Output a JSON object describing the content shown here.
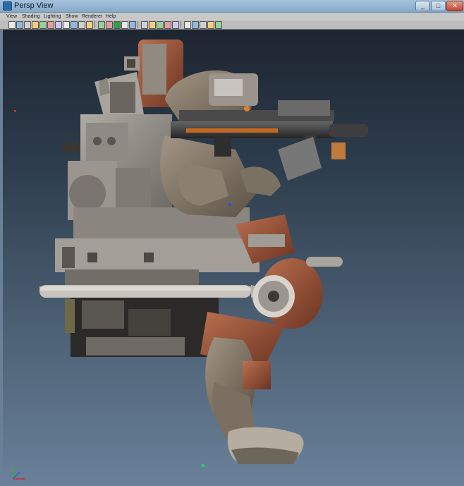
{
  "window": {
    "title": "Persp View"
  },
  "title_buttons": [
    {
      "name": "minimize-button",
      "glyph": "_"
    },
    {
      "name": "maximize-button",
      "glyph": "□"
    },
    {
      "name": "close-button",
      "glyph": "✕"
    }
  ],
  "menu": [
    "View",
    "Shading",
    "Lighting",
    "Show",
    "Renderer",
    "Help"
  ],
  "toolbar_icons": [
    "camera-select-icon",
    "camera-attributes-icon",
    "bookmark-icon",
    "image-plane-icon",
    "grid-icon",
    "film-gate-icon",
    "resolution-gate-icon",
    "gate-mask-icon",
    "field-chart-icon",
    "safe-action-icon",
    "safe-title-icon",
    "wireframe-icon",
    "smooth-shade-icon",
    "wireframe-on-shaded-icon",
    "textured-icon",
    "use-all-lights-icon",
    "shadows-icon",
    "x-ray-icon",
    "backface-cull-icon",
    "isolate-select-icon",
    "highlight-icon",
    "ambient-occlusion-icon",
    "motion-blur-icon",
    "anti-alias-icon",
    "depth-of-field-icon",
    "render-view-icon"
  ],
  "colors": {
    "toolbar_accent": "#2fa04a",
    "axis_x": "#d03030",
    "axis_y": "#30b040",
    "axis_z": "#3060d0"
  }
}
